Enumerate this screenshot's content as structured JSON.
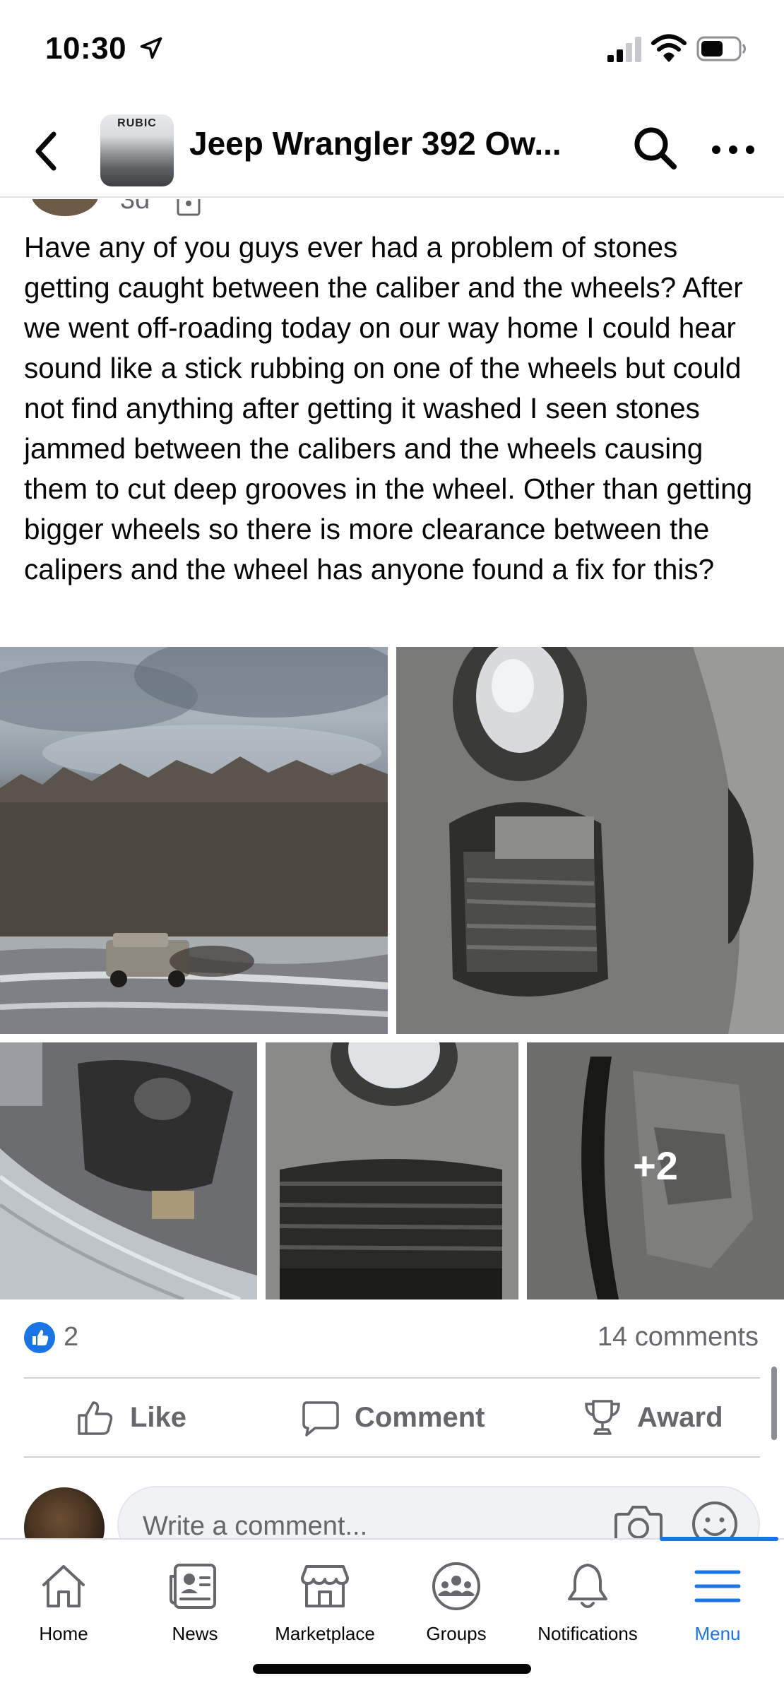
{
  "status_bar": {
    "time": "10:30"
  },
  "header": {
    "group_thumbnail_text": "RUBIC",
    "title": "Jeep Wrangler 392 Ow..."
  },
  "post": {
    "age": "3d",
    "text": "Have any of you guys ever had a problem of stones getting caught between the caliber and the wheels? After we went off-roading today on our way home I could hear sound like a stick rubbing on one of the wheels but could not find anything after getting it washed I seen stones jammed between the calibers and the wheels causing them to cut deep grooves in the wheel. Other than getting bigger wheels so there is more clearance between the calipers and the wheel has anyone found a fix for this?",
    "more_photos_count": "+2",
    "reaction_count": "2",
    "comment_count": "14 comments"
  },
  "actions": {
    "like": "Like",
    "comment": "Comment",
    "award": "Award"
  },
  "composer": {
    "placeholder": "Write a comment..."
  },
  "bottom_nav": {
    "items": [
      {
        "label": "Home",
        "icon": "home-icon"
      },
      {
        "label": "News",
        "icon": "news-icon"
      },
      {
        "label": "Marketplace",
        "icon": "marketplace-icon"
      },
      {
        "label": "Groups",
        "icon": "groups-icon"
      },
      {
        "label": "Notifications",
        "icon": "bell-icon"
      },
      {
        "label": "Menu",
        "icon": "menu-icon",
        "active": true
      }
    ]
  },
  "colors": {
    "accent": "#1b74e4",
    "secondary_text": "#65676b",
    "divider": "#ced0d4"
  }
}
